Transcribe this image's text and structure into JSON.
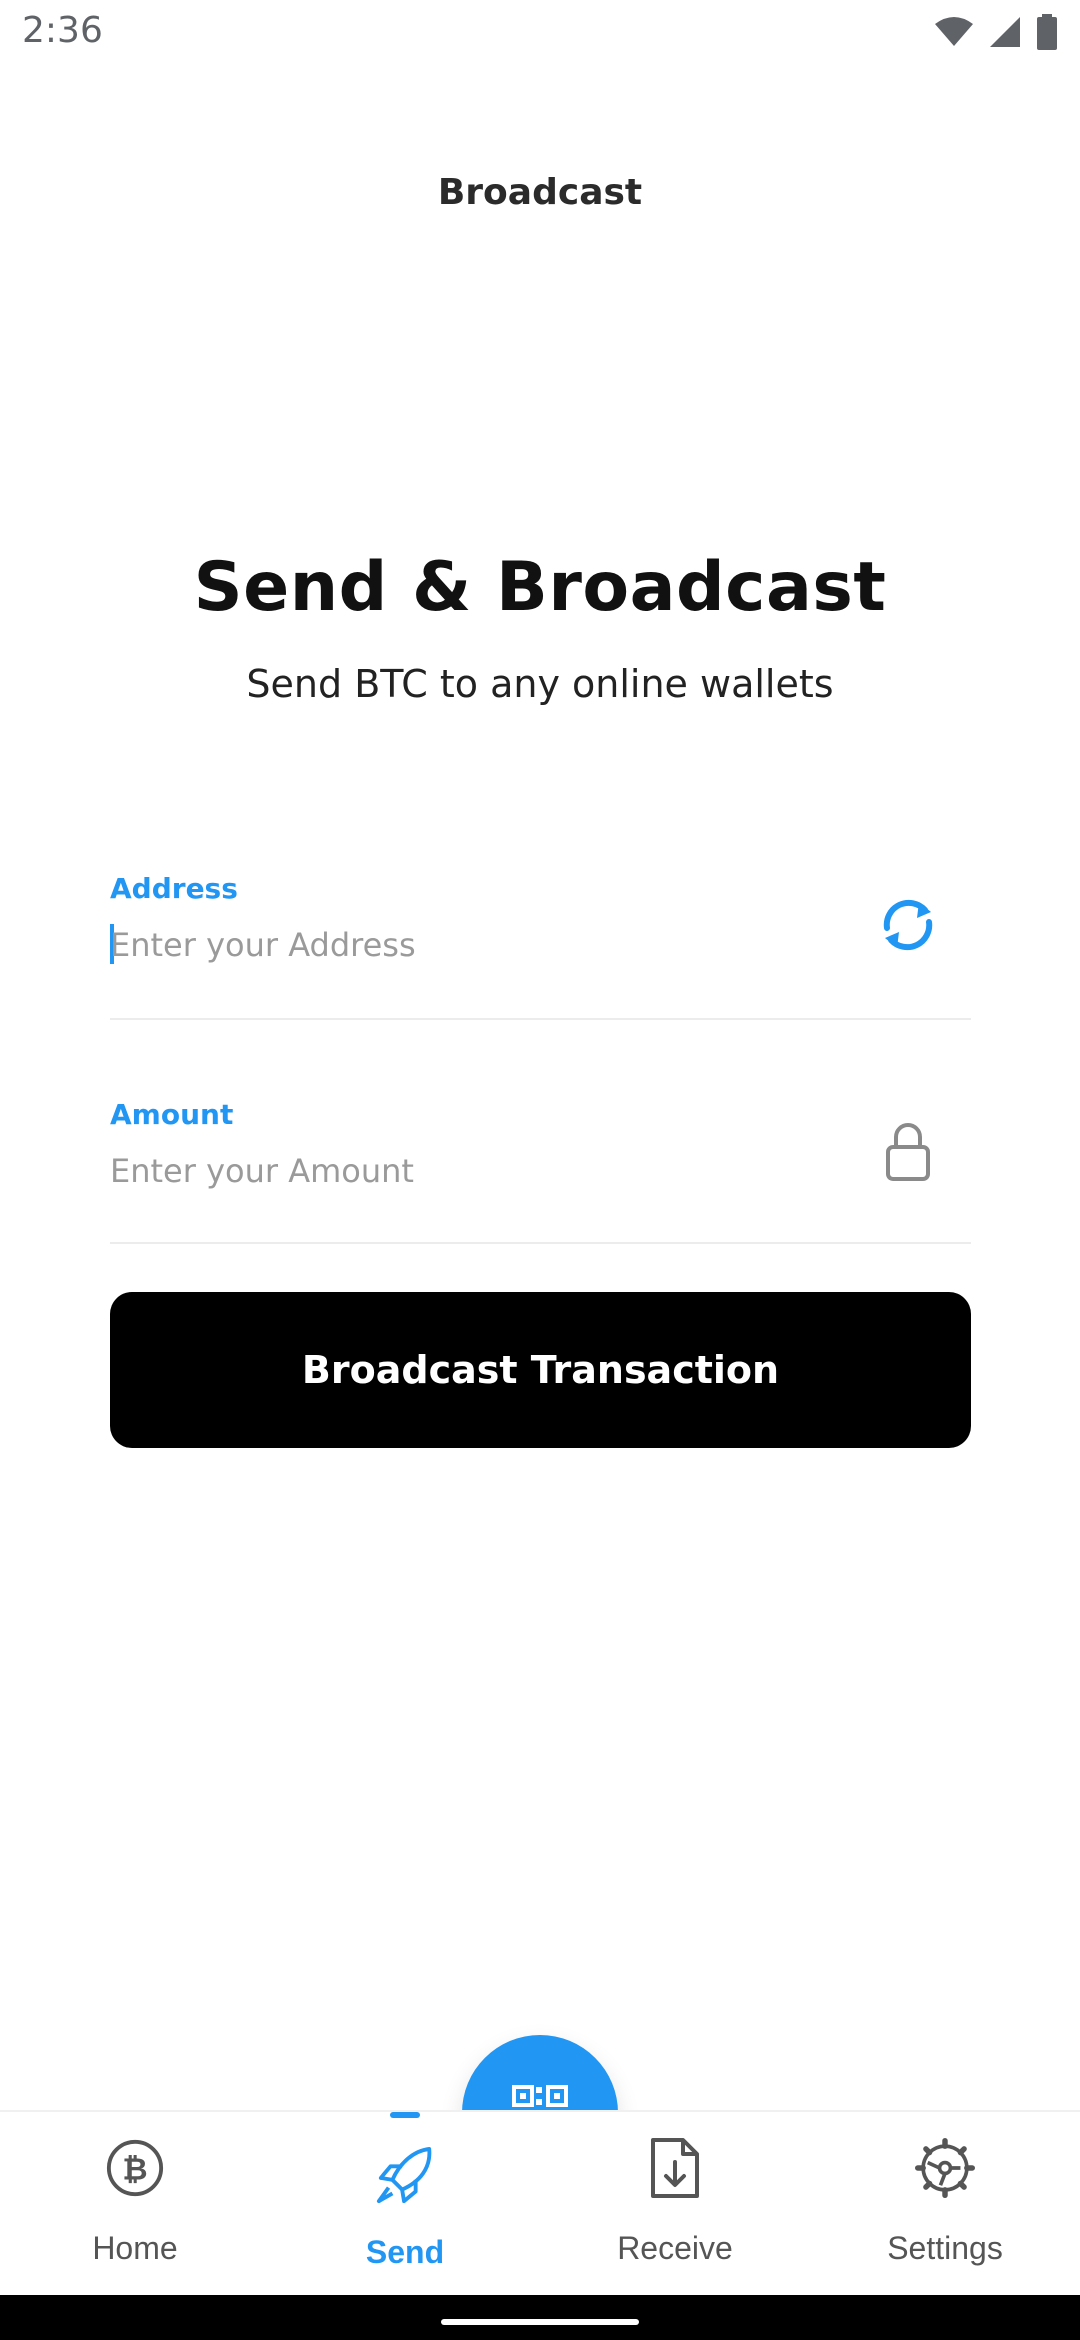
{
  "status_bar": {
    "time": "2:36"
  },
  "app_bar": {
    "title": "Broadcast"
  },
  "hero": {
    "title": "Send & Broadcast",
    "subtitle": "Send BTC to any online wallets"
  },
  "form": {
    "address": {
      "label": "Address",
      "placeholder": "Enter your Address",
      "value": ""
    },
    "amount": {
      "label": "Amount",
      "placeholder": "Enter your Amount",
      "value": ""
    },
    "submit_label": "Broadcast Transaction"
  },
  "bottom_nav": {
    "items": [
      {
        "label": "Home",
        "icon": "bitcoin-icon",
        "active": false
      },
      {
        "label": "Send",
        "icon": "rocket-icon",
        "active": true
      },
      {
        "label": "Receive",
        "icon": "download-file-icon",
        "active": false
      },
      {
        "label": "Settings",
        "icon": "settings-gear-icon",
        "active": false
      }
    ],
    "fab_icon": "qr-code-icon"
  },
  "colors": {
    "accent": "#2196f3",
    "button": "#000000",
    "text": "#111111",
    "muted": "#9a9a9a"
  }
}
